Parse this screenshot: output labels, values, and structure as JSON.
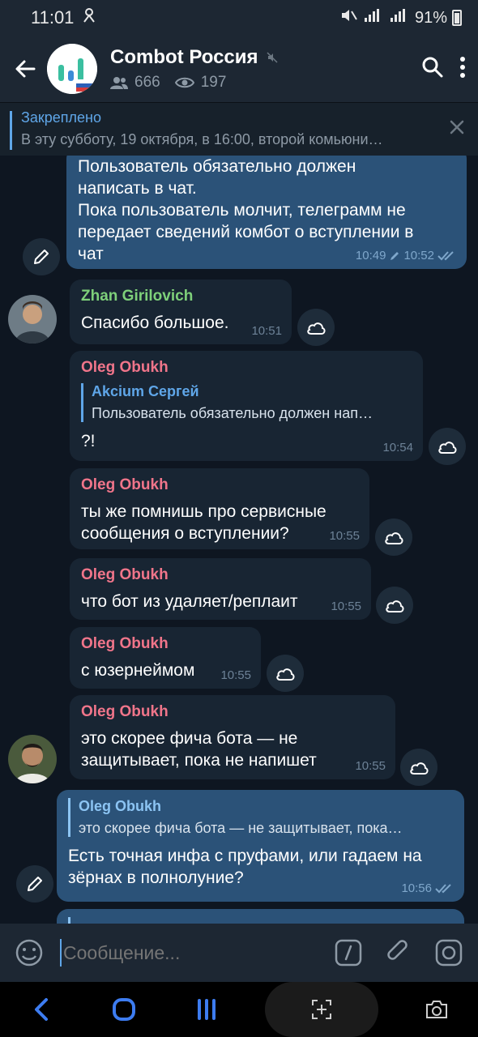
{
  "status": {
    "time": "11:01",
    "battery": "91%"
  },
  "header": {
    "title": "Combot Россия",
    "members": "666",
    "viewers": "197"
  },
  "pinned": {
    "label": "Закреплено",
    "text": "В эту субботу, 19 октября, в 16:00, второй комьюни…"
  },
  "messages": [
    {
      "type": "out",
      "text_lines": [
        "Пользователь обязательно должен",
        "написать в чат.",
        "Пока пользователь молчит, телеграмм не",
        "передает сведений комбот о вступлении в",
        "чат"
      ],
      "time_edit": "10:49",
      "time": "10:52"
    },
    {
      "type": "in",
      "sender": "Zhan Girilovich",
      "text": "Спасибо большое.",
      "time": "10:51"
    },
    {
      "type": "in",
      "sender": "Oleg Obukh",
      "reply_name": "Akcium Сергей",
      "reply_text": "Пользователь обязательно должен нап…",
      "text": "?!",
      "time": "10:54"
    },
    {
      "type": "in",
      "sender": "Oleg Obukh",
      "text_lines": [
        "ты же помнишь про сервисные",
        "сообщения о вступлении?"
      ],
      "time": "10:55"
    },
    {
      "type": "in",
      "sender": "Oleg Obukh",
      "text": "что бот из удаляет/реплаит",
      "time": "10:55"
    },
    {
      "type": "in",
      "sender": "Oleg Obukh",
      "text": "с юзернеймом",
      "time": "10:55"
    },
    {
      "type": "in",
      "sender": "Oleg Obukh",
      "text_lines": [
        "это скорее фича бота — не",
        "защитывает, пока не напишет"
      ],
      "time": "10:55"
    },
    {
      "type": "out",
      "reply_name": "Oleg Obukh",
      "reply_text": "это скорее фича бота — не защитывает, пока…",
      "text_lines": [
        "Есть точная инфа с пруфами, или гадаем на",
        "зёрнах в полнолуние?"
      ],
      "time": "10:56"
    }
  ],
  "input": {
    "placeholder": "Сообщение..."
  },
  "colors": {
    "sender_oleg": "#f0758a",
    "sender_zhan": "#7ed07a",
    "accent": "#5fa6e8",
    "out_bubble": "#2b5278",
    "in_bubble": "#182533"
  }
}
